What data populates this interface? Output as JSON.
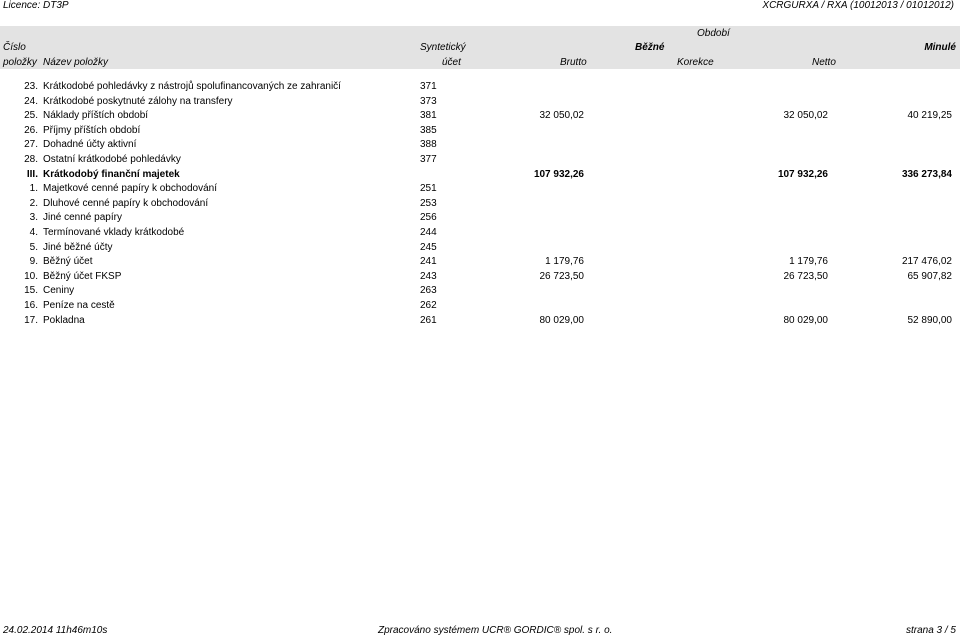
{
  "top": {
    "licence": "Licence: DT3P",
    "report_code": "XCRGURXA / RXA  (10012013 / 01012012)"
  },
  "header": {
    "obdobi": "Období",
    "cislo": "Číslo",
    "polozky": "položky",
    "nazev": "Název položky",
    "synteticky": "Syntetický",
    "ucet": "účet",
    "bezne": "Běžné",
    "minule": "Minulé",
    "brutto": "Brutto",
    "korekce": "Korekce",
    "netto": "Netto"
  },
  "rows": [
    {
      "num": "23.",
      "name": "Krátkodobé pohledávky z nástrojů spolufinancovaných ze zahraničí",
      "acct": "371",
      "brutto": "",
      "netto": "",
      "minule": "",
      "section": false
    },
    {
      "num": "24.",
      "name": "Krátkodobé poskytnuté zálohy na transfery",
      "acct": "373",
      "brutto": "",
      "netto": "",
      "minule": "",
      "section": false
    },
    {
      "num": "25.",
      "name": "Náklady příštích období",
      "acct": "381",
      "brutto": "32 050,02",
      "netto": "32 050,02",
      "minule": "40 219,25",
      "section": false
    },
    {
      "num": "26.",
      "name": "Příjmy příštích období",
      "acct": "385",
      "brutto": "",
      "netto": "",
      "minule": "",
      "section": false
    },
    {
      "num": "27.",
      "name": "Dohadné účty aktivní",
      "acct": "388",
      "brutto": "",
      "netto": "",
      "minule": "",
      "section": false
    },
    {
      "num": "28.",
      "name": "Ostatní krátkodobé pohledávky",
      "acct": "377",
      "brutto": "",
      "netto": "",
      "minule": "",
      "section": false
    },
    {
      "num": "III.",
      "name": "Krátkodobý finanční majetek",
      "acct": "",
      "brutto": "107 932,26",
      "netto": "107 932,26",
      "minule": "336 273,84",
      "section": true
    },
    {
      "num": "1.",
      "name": "Majetkové cenné papíry k obchodování",
      "acct": "251",
      "brutto": "",
      "netto": "",
      "minule": "",
      "section": false
    },
    {
      "num": "2.",
      "name": "Dluhové cenné papíry k obchodování",
      "acct": "253",
      "brutto": "",
      "netto": "",
      "minule": "",
      "section": false
    },
    {
      "num": "3.",
      "name": "Jiné cenné papíry",
      "acct": "256",
      "brutto": "",
      "netto": "",
      "minule": "",
      "section": false
    },
    {
      "num": "4.",
      "name": "Termínované vklady krátkodobé",
      "acct": "244",
      "brutto": "",
      "netto": "",
      "minule": "",
      "section": false
    },
    {
      "num": "5.",
      "name": "Jiné běžné účty",
      "acct": "245",
      "brutto": "",
      "netto": "",
      "minule": "",
      "section": false
    },
    {
      "num": "9.",
      "name": "Běžný účet",
      "acct": "241",
      "brutto": "1 179,76",
      "netto": "1 179,76",
      "minule": "217 476,02",
      "section": false
    },
    {
      "num": "10.",
      "name": "Běžný účet FKSP",
      "acct": "243",
      "brutto": "26 723,50",
      "netto": "26 723,50",
      "minule": "65 907,82",
      "section": false
    },
    {
      "num": "15.",
      "name": "Ceniny",
      "acct": "263",
      "brutto": "",
      "netto": "",
      "minule": "",
      "section": false
    },
    {
      "num": "16.",
      "name": "Peníze na cestě",
      "acct": "262",
      "brutto": "",
      "netto": "",
      "minule": "",
      "section": false
    },
    {
      "num": "17.",
      "name": "Pokladna",
      "acct": "261",
      "brutto": "80 029,00",
      "netto": "80 029,00",
      "minule": "52 890,00",
      "section": false
    }
  ],
  "footer": {
    "date": "24.02.2014 11h46m10s",
    "system": "Zpracováno systémem UCR® GORDIC® spol. s  r. o.",
    "page": "strana 3 / 5"
  }
}
